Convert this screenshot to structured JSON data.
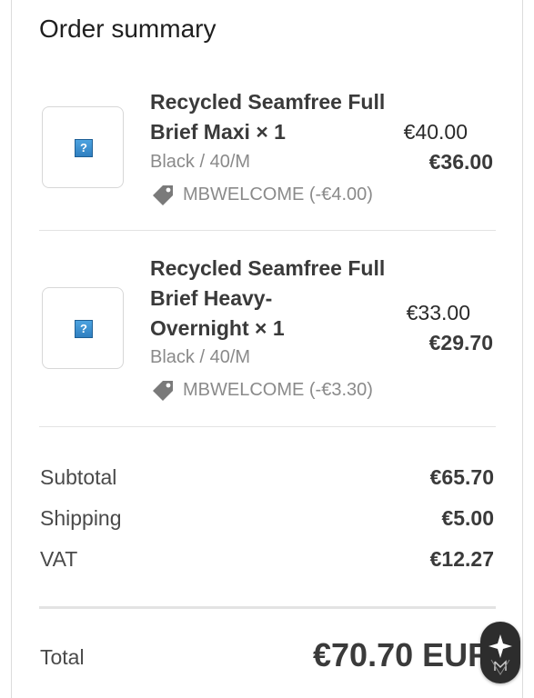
{
  "summary": {
    "title": "Order summary"
  },
  "items": [
    {
      "name_line1": "Recycled Seamfree Full",
      "name_line2": "Brief Maxi × 1",
      "variant": "Black / 40/M",
      "discount": "MBWELCOME (-€4.00)",
      "original_price": "€40.00",
      "final_price": "€36.00",
      "image_icon": "broken-image-icon"
    },
    {
      "name_line1": "Recycled Seamfree Full",
      "name_line2": "Brief Heavy-",
      "name_line3": "Overnight × 1",
      "variant": "Black / 40/M",
      "discount": "MBWELCOME (-€3.30)",
      "original_price": "€33.00",
      "final_price": "€29.70",
      "image_icon": "broken-image-icon"
    }
  ],
  "totals": {
    "subtotal_label": "Subtotal",
    "subtotal_value": "€65.70",
    "shipping_label": "Shipping",
    "shipping_value": "€5.00",
    "vat_label": "VAT",
    "vat_value": "€12.27",
    "total_label": "Total",
    "total_value": "€70.70 EUR"
  },
  "colors": {
    "accent_dark": "#2d2d2d",
    "tag_gray": "#7a7a7a",
    "divider": "#e3e3e3"
  },
  "chat_icon": "chat-widget-icon"
}
